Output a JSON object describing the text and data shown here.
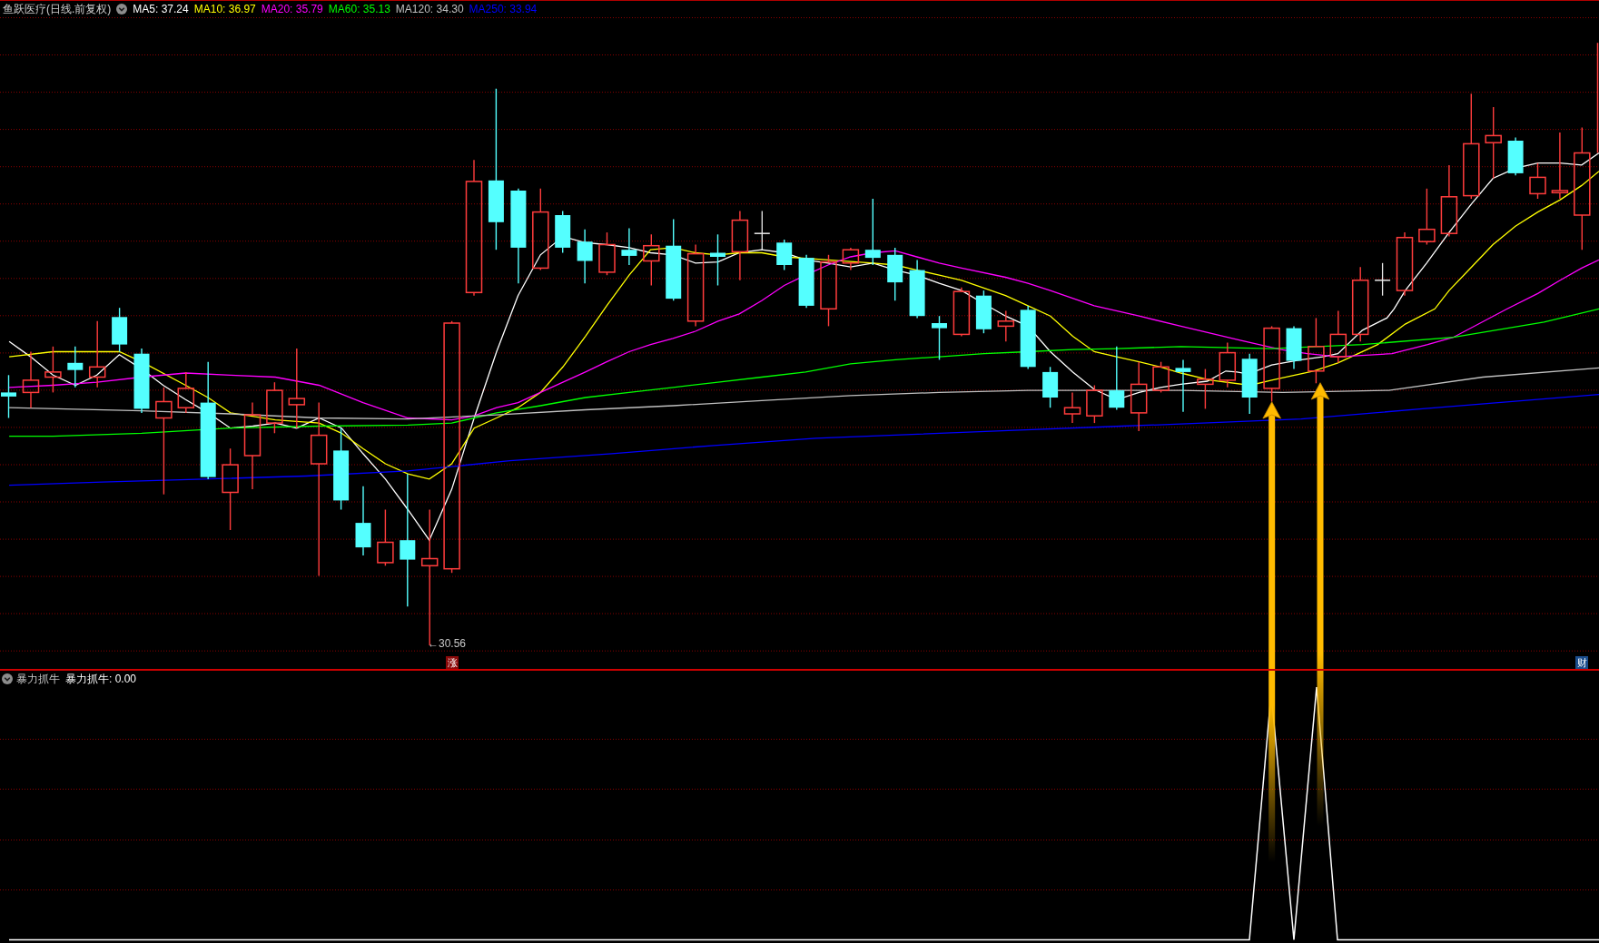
{
  "main_chart": {
    "title": "鱼跃医疗(日线.前复权)",
    "moving_averages": [
      {
        "label": "MA5: 37.24",
        "color": "#ffffff"
      },
      {
        "label": "MA10: 36.97",
        "color": "#ffff00"
      },
      {
        "label": "MA20: 35.79",
        "color": "#ff00ff"
      },
      {
        "label": "MA60: 35.13",
        "color": "#00ff00"
      },
      {
        "label": "MA120: 34.30",
        "color": "#c0c0c0"
      },
      {
        "label": "MA250: 33.94",
        "color": "#0000ff"
      }
    ],
    "low_price_label": "←30.56",
    "markers": [
      {
        "kind": "limit_up",
        "text": "涨"
      },
      {
        "kind": "finance",
        "text": "财"
      }
    ]
  },
  "indicator_panel": {
    "name": "暴力抓牛",
    "readout": "暴力抓牛: 0.00"
  }
}
